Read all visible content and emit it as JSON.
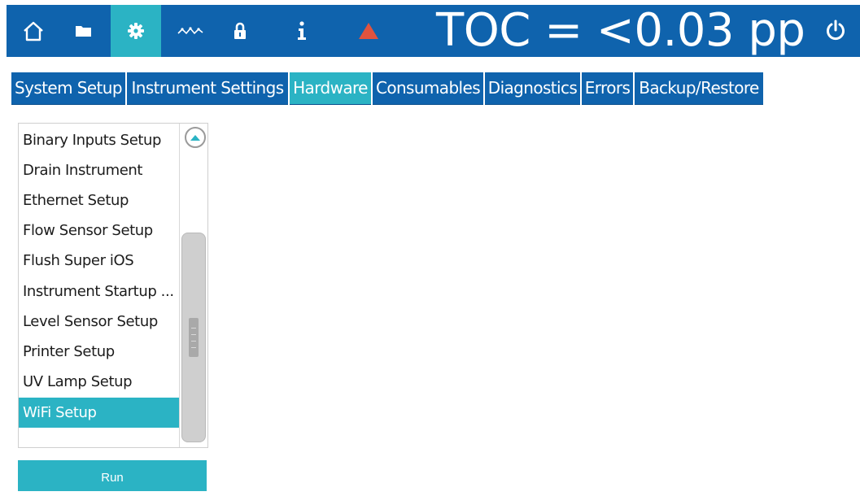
{
  "header": {
    "icons": [
      "home-icon",
      "folder-icon",
      "gear-icon",
      "trend-icon",
      "lock-icon",
      "info-icon",
      "alarm-icon"
    ],
    "active_icon": "gear-icon",
    "toc_reading": "TOC = <0.03 pp",
    "power_icon": "power-icon",
    "colors": {
      "bar": "#0f63ad",
      "active": "#2bb3c4",
      "alarm": "#e0533f"
    }
  },
  "tabs": [
    {
      "label": "System Setup"
    },
    {
      "label": "Instrument Settings"
    },
    {
      "label": "Hardware",
      "active": true
    },
    {
      "label": "Consumables"
    },
    {
      "label": "Diagnostics"
    },
    {
      "label": "Errors"
    },
    {
      "label": "Backup/Restore"
    }
  ],
  "list": {
    "items": [
      "Binary Inputs Setup",
      "Drain Instrument",
      "Ethernet Setup",
      "Flow Sensor Setup",
      "Flush Super iOS",
      "Instrument Startup ...",
      "Level Sensor Setup",
      "Printer Setup",
      "UV Lamp Setup",
      "WiFi Setup"
    ],
    "selected": "WiFi Setup"
  },
  "run_button": {
    "label": "Run"
  }
}
